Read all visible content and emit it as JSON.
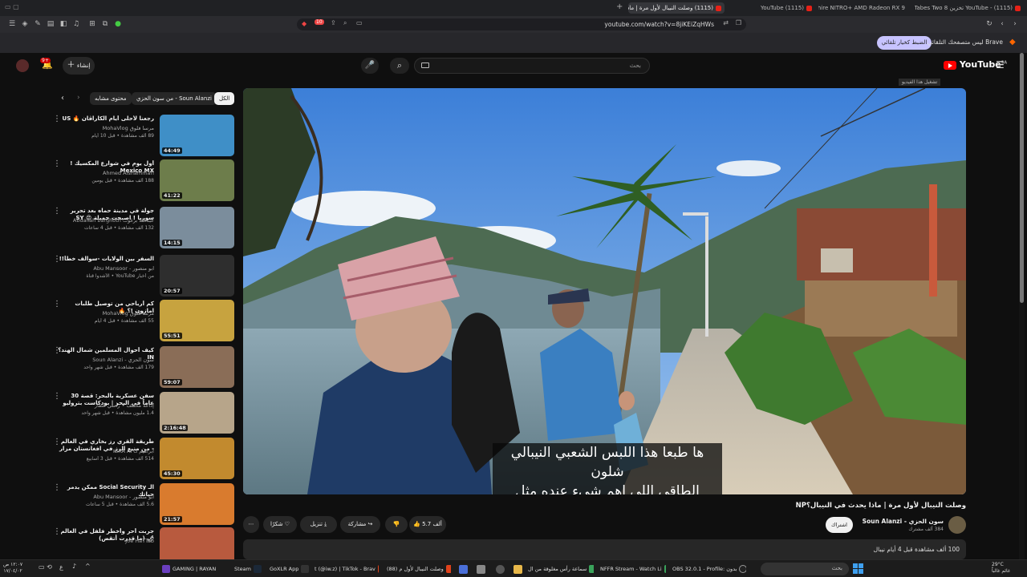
{
  "browser": {
    "tabs": [
      {
        "label": "YouTube - (1115) تخزين 8 Tabes Two مع أجو",
        "active": false
      },
      {
        "label": "Sapphire NITRO+ AMD Radeon RX 9",
        "active": false
      },
      {
        "label": "YouTube (1115)",
        "active": false
      },
      {
        "label": "(1115) وصلت النيبال لأول مرة | ماذا",
        "active": true
      }
    ],
    "url": "youtube.com/watch?v=8jiKEiZqHWs",
    "shield_count": "10",
    "infobar_text": "Brave ليس متصفحك التلقائي",
    "infobar_button": "الضبط كخيار تلقائي"
  },
  "youtube": {
    "logo_text": "YouTube",
    "logo_region": "SA",
    "search_placeholder": "بحث",
    "create_label": "إنشاء",
    "notification_count": "9+",
    "chips": [
      "الكل",
      "من سون الحزي - Soun Alanzi",
      "محتوى مشابه"
    ],
    "related": [
      {
        "title": "رجعنا لأحلى أيام الكاراڤان 🔥 US",
        "channel": "مرسا فلوق MohaVlog",
        "meta": "89 ألف مشاهدة • قبل 10 أيام",
        "duration": "44:49"
      },
      {
        "title": "أول يوم في شوارع المكسيك ! Mexico MX",
        "channel": "Ahmed Alshammari",
        "meta": "188 ألف مشاهدة • قبل يومين",
        "duration": "41:22"
      },
      {
        "title": "جولة في مدينة حماه بعد تحرير سوريا ! اصبحت جميلة 😍 SY",
        "channel": "عبدالله برغوث Abdallah barghoth",
        "meta": "132 ألف مشاهدة • قبل 4 ساعات",
        "duration": "14:15"
      },
      {
        "title": "السفر بين الولايات -سوالف خطأ!!",
        "channel": "ابو منصور - Abu Mansoor",
        "meta": "من أخبار YouTube • الأشدوا قناة",
        "duration": "20:57"
      },
      {
        "title": "كم أرباحي من توصيل طلبات امازون !؟ 🔥",
        "channel": "مرسا فلوق MohaVlog",
        "meta": "55 ألف مشاهدة • قبل 4 أيام",
        "duration": "55:51"
      },
      {
        "title": "كيف أحوال المسلمين شمال الهند؟IN",
        "channel": "سون الحزي - Soun Alanzi",
        "meta": "179 ألف مشاهدة • قبل شهر واحد",
        "duration": "59:07"
      },
      {
        "title": "سفن عسكرية بالبحر: قصة 30 عاماً في البحر | بودكاست بتروليو",
        "channel": "إذاعة مختلف • رأسي غطار",
        "meta": "1.4 مليون مشاهدة • قبل شهر واحد",
        "duration": "2:16:48"
      },
      {
        "title": "طريقة القري رز بخاري في العالم - من منبع الرز في افغانستان مزار شريف | افغاني",
        "channel": "ابراهيم IBRA AFG",
        "meta": "514 ألف مشاهدة • قبل 3 أسابيع",
        "duration": "45:30"
      },
      {
        "title": "الـ Social Security ممكن يدمر حياتك",
        "channel": "ابو منصور - Abu Mansoor",
        "meta": "5.6 ألف مشاهدة • قبل 5 ساعات",
        "duration": "21:57"
      },
      {
        "title": "جربت أحر وأخطر فلفل في العالم 🌶 (ما قدرت أتقض)",
        "channel": "Joe HaTTab",
        "meta": "",
        "duration": ""
      }
    ],
    "subtitles": [
      "ها طبعا هذا اللبس الشعبي النيبالي شلون",
      "الطاقي اللي اهم شيء عنده مثل الشماغ"
    ],
    "miniplayer_tag": "تشغيل هذا الفيديو",
    "video": {
      "title": "وصلت النيبال لأول مرة | ماذا يحدث في النيبال؟NP",
      "channel": "سون الحزي - Soun Alanzi",
      "subscribers": "384 ألف مشترك",
      "subscribe_label": "اشتراك",
      "likes": "5.7 ألف",
      "share_label": "مشاركة",
      "download_label": "تنزيل",
      "thanks_label": "شكرًا",
      "description": "100 ألف مشاهدة قبل 4 أيام نيبال"
    }
  },
  "taskbar": {
    "search_placeholder": "بحث",
    "items": [
      "OBS 32.0.1 - Profile: بدون",
      "NFFR Stream - Watch Li",
      "سماعة رأس مغلوقة من ال",
      "(88) وصلت النيبال لأول م",
      "t (@iw.z) | TikTok - Brav",
      "GoXLR App",
      "Steam",
      "GAMING | RAYAN"
    ],
    "clock_time": "١٢:٠٧ ص",
    "clock_date": "١٧/٠٤/٠٢",
    "weather_temp": "29°C",
    "weather_text": "غائم غالباً"
  }
}
